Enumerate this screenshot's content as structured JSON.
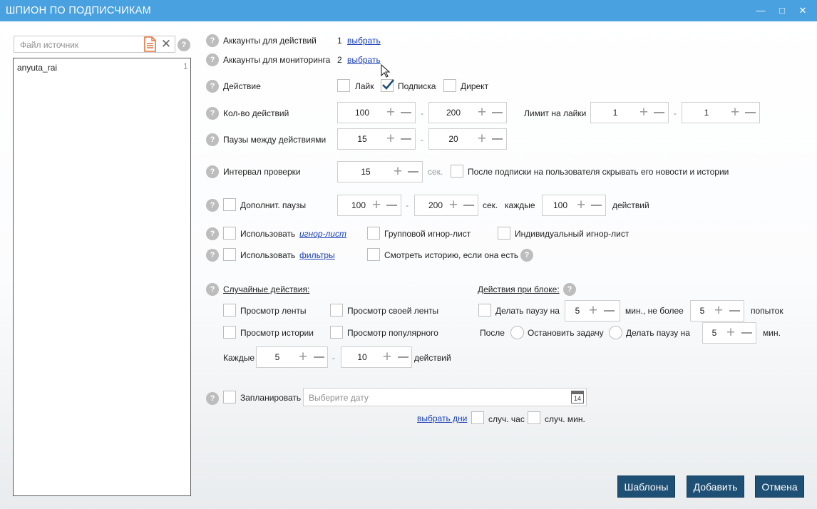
{
  "window": {
    "title": "ШПИОН ПО ПОДПИСЧИКАМ",
    "minimize_glyph": "—",
    "maximize_glyph": "□",
    "close_glyph": "✕"
  },
  "source": {
    "placeholder": "Файл источник",
    "file_icon": "document-icon",
    "clear_glyph": "✕",
    "help_glyph": "?",
    "items": [
      {
        "name": "anyuta_rai",
        "count": "1"
      }
    ]
  },
  "help_glyph": "?",
  "accounts_actions": {
    "label": "Аккаунты для действий",
    "count": "1",
    "link": "выбрать"
  },
  "accounts_monitoring": {
    "label": "Аккаунты для мониторинга",
    "count": "2",
    "link": "выбрать"
  },
  "action": {
    "label": "Действие",
    "like": "Лайк",
    "like_checked": false,
    "follow": "Подписка",
    "follow_checked": true,
    "direct": "Директ",
    "direct_checked": false
  },
  "actions_count": {
    "label": "Кол-во действий",
    "from": "100",
    "to": "200",
    "dash": "-"
  },
  "like_limit": {
    "label": "Лимит на лайки",
    "from": "1",
    "to": "1",
    "dash": "-"
  },
  "pauses": {
    "label": "Паузы между действиями",
    "from": "15",
    "to": "20",
    "dash": "-"
  },
  "check_interval": {
    "label": "Интервал проверки",
    "value": "15",
    "unit": "сек."
  },
  "hide_news": {
    "label": "После подписки на пользователя скрывать его новости и истории",
    "checked": false
  },
  "extra_pauses": {
    "label": "Дополнит. паузы",
    "from": "100",
    "to": "200",
    "dash": "-",
    "unit": "сек.",
    "every": "каждые",
    "count": "100",
    "actions": "действий"
  },
  "ignore": {
    "use": "Использовать",
    "link": "игнор-лист",
    "group": "Групповой игнор-лист",
    "individual": "Индивидуальный игнор-лист"
  },
  "filters": {
    "use": "Использовать",
    "link": "фильтры",
    "story": "Смотреть историю, если она есть"
  },
  "random": {
    "title": "Случайные действия:",
    "feed": "Просмотр ленты",
    "own_feed": "Просмотр своей ленты",
    "stories": "Просмотр истории",
    "popular": "Просмотр популярного",
    "every": "Каждые",
    "from": "5",
    "to": "10",
    "dash": "-",
    "actions": "действий"
  },
  "block": {
    "title": "Действия при блоке:",
    "pause": "Делать паузу на",
    "pause_value": "5",
    "min_not_more": "мин., не более",
    "attempts_value": "5",
    "attempts": "попыток",
    "after": "После",
    "stop": "Остановить задачу",
    "pause2": "Делать паузу на",
    "pause2_value": "5",
    "min": "мин."
  },
  "schedule": {
    "label": "Запланировать",
    "placeholder": "Выберите дату",
    "calendar_day": "14",
    "select_days": "выбрать дни",
    "rand_hour": "случ. час",
    "rand_min": "случ. мин."
  },
  "buttons": {
    "templates": "Шаблоны",
    "add": "Добавить",
    "cancel": "Отмена"
  },
  "colors": {
    "titlebar": "#4aa1df",
    "button": "#1e4f74",
    "link": "#1a3fb8",
    "file_icon": "#e8743a",
    "help": "#bdbdbd",
    "check": "#1f4e79"
  }
}
